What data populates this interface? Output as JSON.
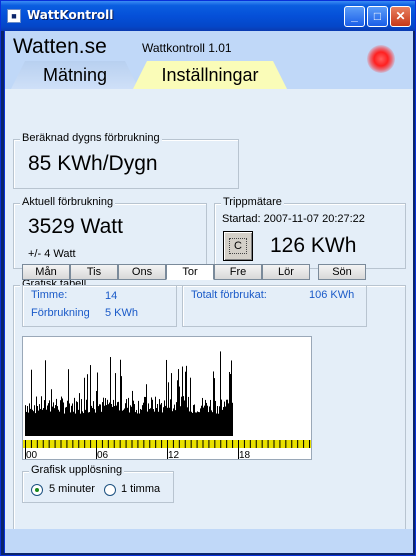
{
  "window": {
    "title": "WattKontroll",
    "icon": "app-icon"
  },
  "header": {
    "brand": "Watten.se",
    "version": "Wattkontroll 1.01",
    "led_color": "#ff2020"
  },
  "tabs": [
    {
      "label": "Mätning"
    },
    {
      "label": "Inställningar"
    }
  ],
  "daily": {
    "legend": "Beräknad dygns förbrukning",
    "value": "85 KWh/Dygn"
  },
  "current": {
    "legend": "Aktuell förbrukning",
    "value": "3529 Watt",
    "tolerance": "+/-  4 Watt"
  },
  "trip": {
    "legend": "Trippmätare",
    "started": "Startad: 2007-11-07 20:27:22",
    "reset_label": "C",
    "value": "126 KWh"
  },
  "table": {
    "legend": "Grafisk tabell",
    "days": [
      "Mån",
      "Tis",
      "Ons",
      "Tor",
      "Fre",
      "Lör",
      "Sön"
    ],
    "active_day": "Tor",
    "hour_label": "Timme:",
    "hour_value": "14",
    "usage_label": "Förbrukning",
    "usage_value": "5 KWh",
    "total_label": "Totalt förbrukat:",
    "total_value": "106 KWh"
  },
  "chart_data": {
    "type": "bar",
    "x_ticks": [
      "00",
      "06",
      "12",
      "18"
    ],
    "x_range_hours": [
      0,
      24
    ],
    "filled_until_hour": 17.5,
    "bar_color": "#000000"
  },
  "resolution": {
    "legend": "Grafisk upplösning",
    "options": [
      "5 minuter",
      "1 timma"
    ],
    "selected": "5 minuter"
  }
}
